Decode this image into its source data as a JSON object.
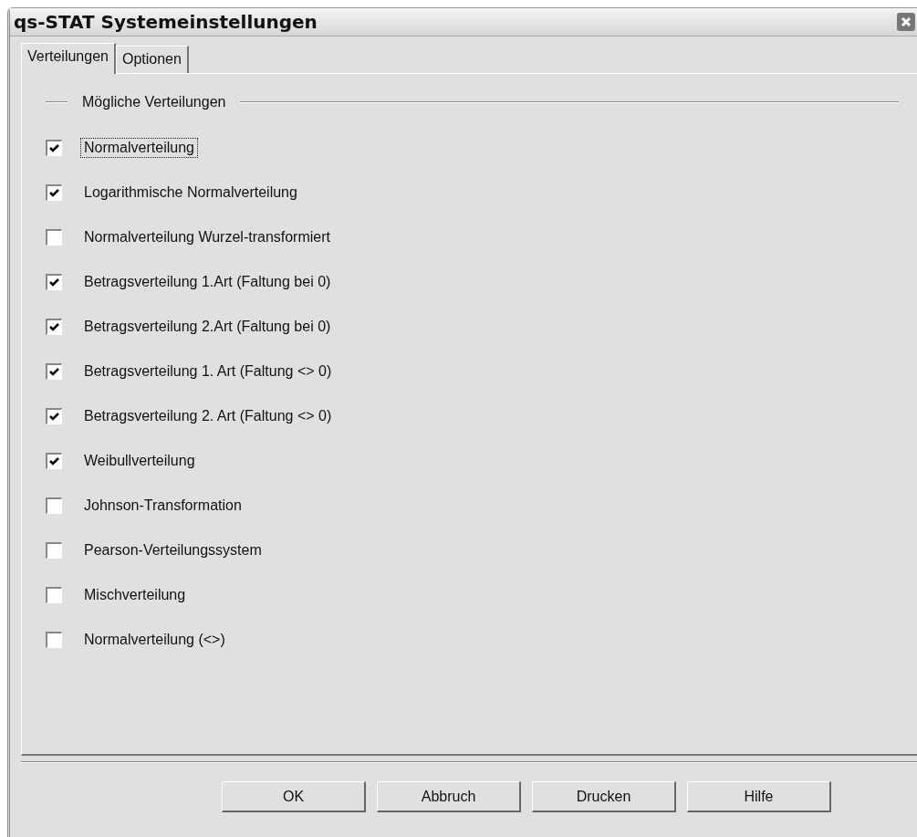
{
  "window": {
    "title": "qs-STAT  Systemeinstellungen"
  },
  "tabs": [
    {
      "label": "Verteilungen",
      "selected": true
    },
    {
      "label": "Optionen",
      "selected": false
    }
  ],
  "group": {
    "title": "Mögliche Verteilungen"
  },
  "options": [
    {
      "label": "Normalverteilung",
      "checked": true,
      "focused": true
    },
    {
      "label": "Logarithmische Normalverteilung",
      "checked": true,
      "focused": false
    },
    {
      "label": "Normalverteilung Wurzel-transformiert",
      "checked": false,
      "focused": false
    },
    {
      "label": "Betragsverteilung 1.Art (Faltung bei 0)",
      "checked": true,
      "focused": false
    },
    {
      "label": "Betragsverteilung 2.Art (Faltung bei 0)",
      "checked": true,
      "focused": false
    },
    {
      "label": "Betragsverteilung 1. Art (Faltung <> 0)",
      "checked": true,
      "focused": false
    },
    {
      "label": "Betragsverteilung 2. Art (Faltung <> 0)",
      "checked": true,
      "focused": false
    },
    {
      "label": "Weibullverteilung",
      "checked": true,
      "focused": false
    },
    {
      "label": "Johnson-Transformation",
      "checked": false,
      "focused": false
    },
    {
      "label": "Pearson-Verteilungssystem",
      "checked": false,
      "focused": false
    },
    {
      "label": "Mischverteilung",
      "checked": false,
      "focused": false
    },
    {
      "label": "Normalverteilung (<>)",
      "checked": false,
      "focused": false
    }
  ],
  "buttons": [
    "OK",
    "Abbruch",
    "Drucken",
    "Hilfe"
  ]
}
